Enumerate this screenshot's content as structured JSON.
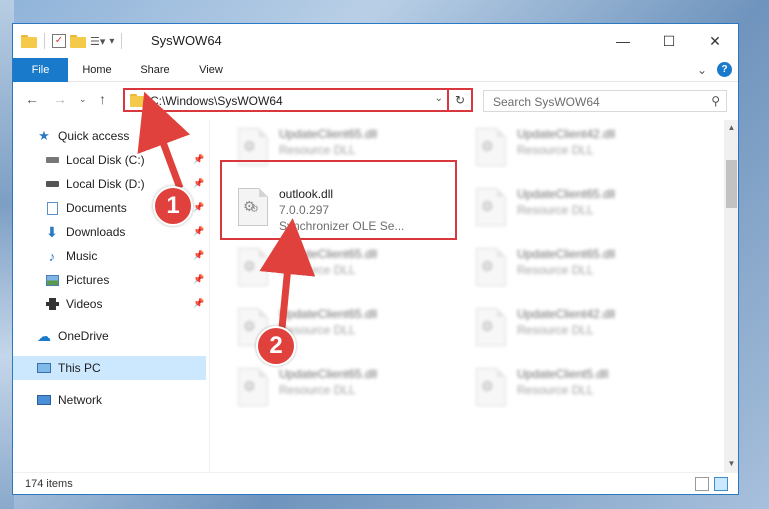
{
  "window": {
    "title": "SysWOW64",
    "controls": {
      "minimize": "—",
      "maximize": "☐",
      "close": "✕"
    }
  },
  "ribbon": {
    "tabs": [
      "File",
      "Home",
      "Share",
      "View"
    ],
    "expand": "⌄",
    "help": "?"
  },
  "address": {
    "path": "C:\\Windows\\SysWOW64",
    "search_placeholder": "Search SysWOW64"
  },
  "nav": {
    "quick_access": "Quick access",
    "pinned": [
      {
        "label": "Local Disk (C:)",
        "icon": "drive-icon"
      },
      {
        "label": "Local Disk (D:)",
        "icon": "drive-icon"
      },
      {
        "label": "Documents",
        "icon": "documents-icon"
      },
      {
        "label": "Downloads",
        "icon": "downloads-icon"
      },
      {
        "label": "Music",
        "icon": "music-icon"
      },
      {
        "label": "Pictures",
        "icon": "pictures-icon"
      },
      {
        "label": "Videos",
        "icon": "videos-icon"
      }
    ],
    "onedrive": "OneDrive",
    "this_pc": "This PC",
    "network": "Network"
  },
  "files": {
    "left": [
      {
        "name": "UpdateClient65.dll",
        "desc": "Resource DLL"
      },
      {
        "name": "outlook.dll",
        "version": "7.0.0.297",
        "desc": "Synchronizer OLE Se..."
      },
      {
        "name": "UpdateClient65.dll",
        "desc": "Resource DLL"
      },
      {
        "name": "UpdateClient65.dll",
        "desc": "Resource DLL"
      },
      {
        "name": "UpdateClient65.dll",
        "desc": "Resource DLL"
      }
    ],
    "right": [
      {
        "name": "UpdateClient42.dll",
        "desc": "Resource DLL"
      },
      {
        "name": "UpdateClient65.dll",
        "desc": "Resource DLL"
      },
      {
        "name": "UpdateClient65.dll",
        "desc": "Resource DLL"
      },
      {
        "name": "UpdateClient42.dll",
        "desc": "Resource DLL"
      },
      {
        "name": "UpdateClient5.dll",
        "desc": "Resource DLL"
      }
    ]
  },
  "status": {
    "count": "174 items"
  },
  "annotations": {
    "badge1": "1",
    "badge2": "2",
    "color": "#e0413c"
  }
}
